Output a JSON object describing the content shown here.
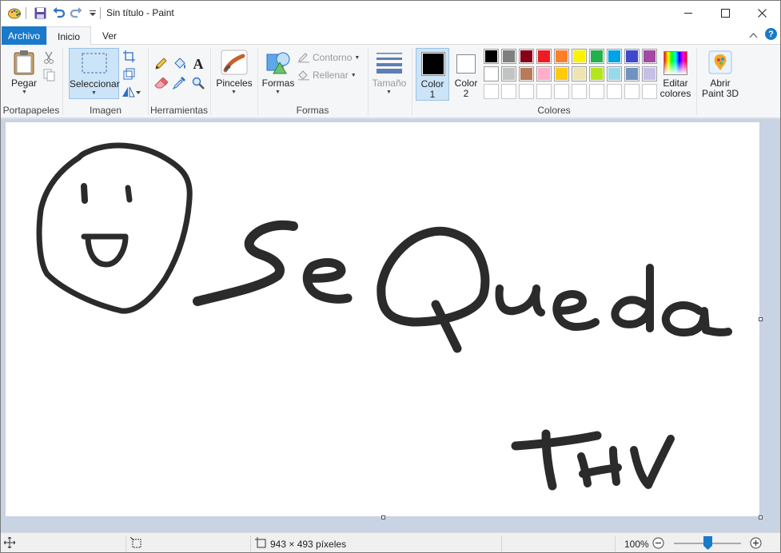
{
  "window": {
    "title": "Sin título - Paint",
    "minimize_icon": "minimize-icon",
    "maximize_icon": "maximize-icon",
    "close_icon": "close-icon"
  },
  "quick_access": [
    "paint-app-icon",
    "save-icon",
    "undo-icon",
    "redo-icon",
    "customize-dropdown-icon"
  ],
  "tabs": [
    {
      "label": "Archivo"
    },
    {
      "label": "Inicio"
    },
    {
      "label": "Ver"
    }
  ],
  "ribbon": {
    "clipboard": {
      "group_label": "Portapapeles",
      "paste_label": "Pegar"
    },
    "image": {
      "group_label": "Imagen",
      "select_label": "Seleccionar"
    },
    "tools": {
      "group_label": "Herramientas"
    },
    "brushes": {
      "label": "Pinceles"
    },
    "shapes": {
      "group_label": "Formas",
      "shapes_label": "Formas",
      "outline_label": "Contorno",
      "fill_label": "Rellenar"
    },
    "size": {
      "label": "Tamaño"
    },
    "colors": {
      "group_label": "Colores",
      "color1_label_line1": "Color",
      "color1_label_line2": "1",
      "color2_label_line1": "Color",
      "color2_label_line2": "2",
      "color1_value": "#000000",
      "color2_value": "#ffffff",
      "edit_colors_line1": "Editar",
      "edit_colors_line2": "colores",
      "palette_row1": [
        "#000000",
        "#7f7f7f",
        "#880015",
        "#ed1c24",
        "#ff7f27",
        "#fff200",
        "#22b14c",
        "#00a2e8",
        "#3f48cc",
        "#a349a4"
      ],
      "palette_row2": [
        "#ffffff",
        "#c3c3c3",
        "#b97a57",
        "#ffaec9",
        "#ffc90e",
        "#efe4b0",
        "#b5e61d",
        "#99d9ea",
        "#7092be",
        "#c8bfe7"
      ]
    },
    "paint3d": {
      "label_line1": "Abrir",
      "label_line2": "Paint 3D"
    }
  },
  "status": {
    "dimensions": "943 × 493 píxeles",
    "zoom": "100%",
    "zoom_level": 1.0
  }
}
